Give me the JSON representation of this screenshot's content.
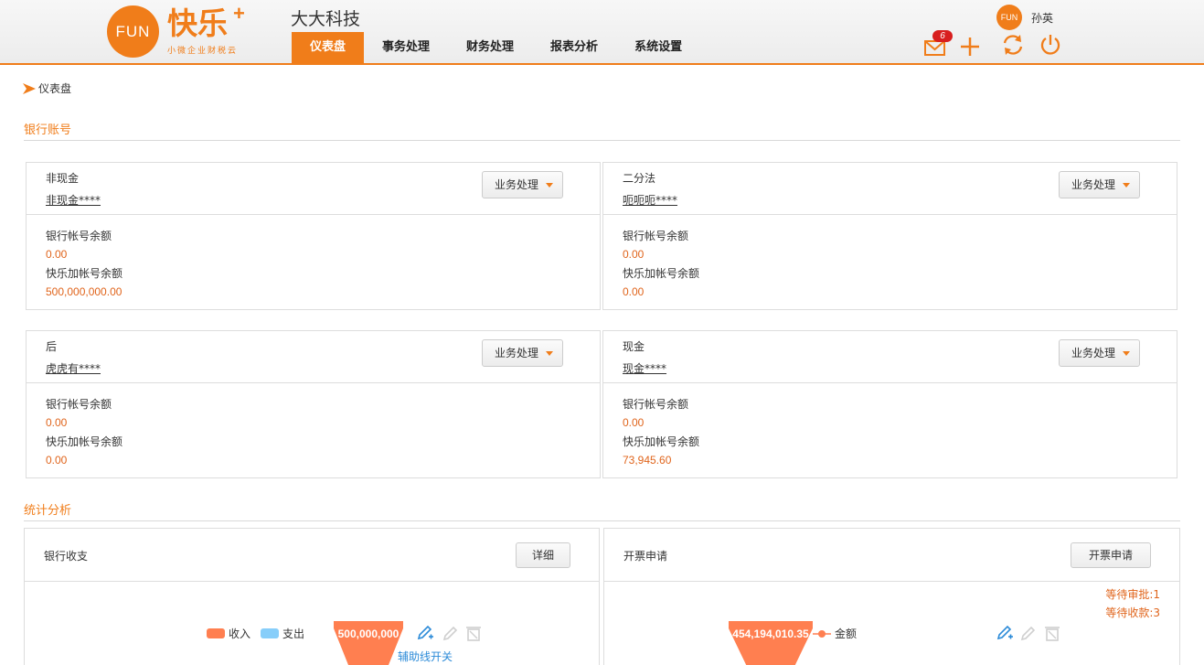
{
  "header": {
    "logo_text": "FUN",
    "logo_name": "快乐",
    "logo_plus": "+",
    "logo_sub": "小微企业财税云",
    "company": "大大科技",
    "nav": [
      {
        "label": "仪表盘",
        "active": true
      },
      {
        "label": "事务处理",
        "active": false
      },
      {
        "label": "财务处理",
        "active": false
      },
      {
        "label": "报表分析",
        "active": false
      },
      {
        "label": "系统设置",
        "active": false
      }
    ],
    "avatar_text": "FUN",
    "username": "孙英",
    "mail_count": "6",
    "accent": "#f07d1a"
  },
  "breadcrumb": {
    "label": "仪表盘"
  },
  "bank_section": {
    "title": "银行账号"
  },
  "accounts": [
    {
      "name": "非现金",
      "acct": "非现金****",
      "button": "业务处理",
      "bank_label": "银行帐号余额",
      "bank_value": "0.00",
      "kl_label": "快乐加帐号余额",
      "kl_value": "500,000,000.00"
    },
    {
      "name": "二分法",
      "acct": "呃呃呃****",
      "button": "业务处理",
      "bank_label": "银行帐号余额",
      "bank_value": "0.00",
      "kl_label": "快乐加帐号余额",
      "kl_value": "0.00"
    },
    {
      "name": "后",
      "acct": "虎虎有****",
      "button": "业务处理",
      "bank_label": "银行帐号余额",
      "bank_value": "0.00",
      "kl_label": "快乐加帐号余额",
      "kl_value": "0.00"
    },
    {
      "name": "现金",
      "acct": "现金****",
      "button": "业务处理",
      "bank_label": "银行帐号余额",
      "bank_value": "0.00",
      "kl_label": "快乐加帐号余额",
      "kl_value": "73,945.60"
    }
  ],
  "stats_section": {
    "title": "统计分析"
  },
  "bank_flow": {
    "title": "银行收支",
    "detail_button": "详细",
    "legend_income": "收入",
    "legend_expense": "支出",
    "income_color": "#ff7f50",
    "expense_color": "#87cefa",
    "funnel_value": "500,000,000",
    "aux_link": "辅助线开关"
  },
  "invoice": {
    "title": "开票申请",
    "button": "开票申请",
    "pending_approval": "等待审批:1",
    "pending_payment": "等待收款:3",
    "funnel_value": "454,194,010.35",
    "legend_amount": "金额"
  },
  "chart_data": [
    {
      "type": "funnel",
      "title": "",
      "legend": [
        "收入",
        "支出"
      ],
      "series": [
        {
          "name": "收入",
          "values": [
            500000000
          ]
        }
      ]
    },
    {
      "type": "funnel",
      "title": "",
      "legend": [
        "金额"
      ],
      "series": [
        {
          "name": "金额",
          "values": [
            454194010.35
          ]
        }
      ]
    }
  ]
}
